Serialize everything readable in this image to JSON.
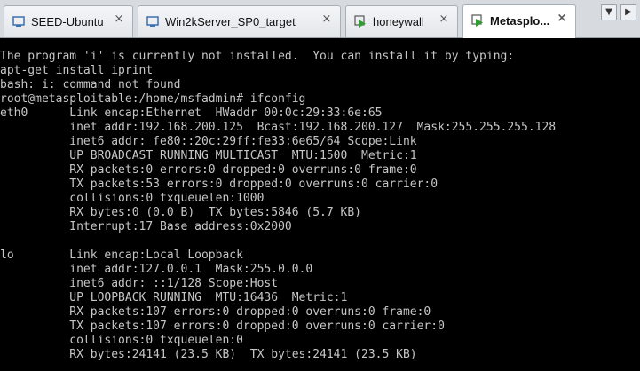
{
  "tabs": [
    {
      "label": "SEED-Ubuntu",
      "icon": "vm-icon",
      "active": false
    },
    {
      "label": "Win2kServer_SP0_target",
      "icon": "vm-icon",
      "active": false
    },
    {
      "label": "honeywall",
      "icon": "vm-running-icon",
      "active": false
    },
    {
      "label": "Metasplo...",
      "icon": "vm-running-icon",
      "active": true
    }
  ],
  "tab_controls": {
    "close_glyph": "×",
    "scroll_down_glyph": "▼",
    "scroll_right_glyph": "▶"
  },
  "terminal": {
    "lines": [
      "The program 'i' is currently not installed.  You can install it by typing:",
      "apt-get install iprint",
      "bash: i: command not found",
      "root@metasploitable:/home/msfadmin# ifconfig",
      "eth0      Link encap:Ethernet  HWaddr 00:0c:29:33:6e:65",
      "          inet addr:192.168.200.125  Bcast:192.168.200.127  Mask:255.255.255.128",
      "          inet6 addr: fe80::20c:29ff:fe33:6e65/64 Scope:Link",
      "          UP BROADCAST RUNNING MULTICAST  MTU:1500  Metric:1",
      "          RX packets:0 errors:0 dropped:0 overruns:0 frame:0",
      "          TX packets:53 errors:0 dropped:0 overruns:0 carrier:0",
      "          collisions:0 txqueuelen:1000",
      "          RX bytes:0 (0.0 B)  TX bytes:5846 (5.7 KB)",
      "          Interrupt:17 Base address:0x2000",
      "",
      "lo        Link encap:Local Loopback",
      "          inet addr:127.0.0.1  Mask:255.0.0.0",
      "          inet6 addr: ::1/128 Scope:Host",
      "          UP LOOPBACK RUNNING  MTU:16436  Metric:1",
      "          RX packets:107 errors:0 dropped:0 overruns:0 frame:0",
      "          TX packets:107 errors:0 dropped:0 overruns:0 carrier:0",
      "          collisions:0 txqueuelen:0",
      "          RX bytes:24141 (23.5 KB)  TX bytes:24141 (23.5 KB)"
    ]
  },
  "colors": {
    "terminal_bg": "#000000",
    "terminal_fg": "#c6c6c6",
    "tabbar_bg": "#d7dbe0",
    "vm_icon": "#3a6fb0",
    "running_icon": "#2e9e2e"
  }
}
